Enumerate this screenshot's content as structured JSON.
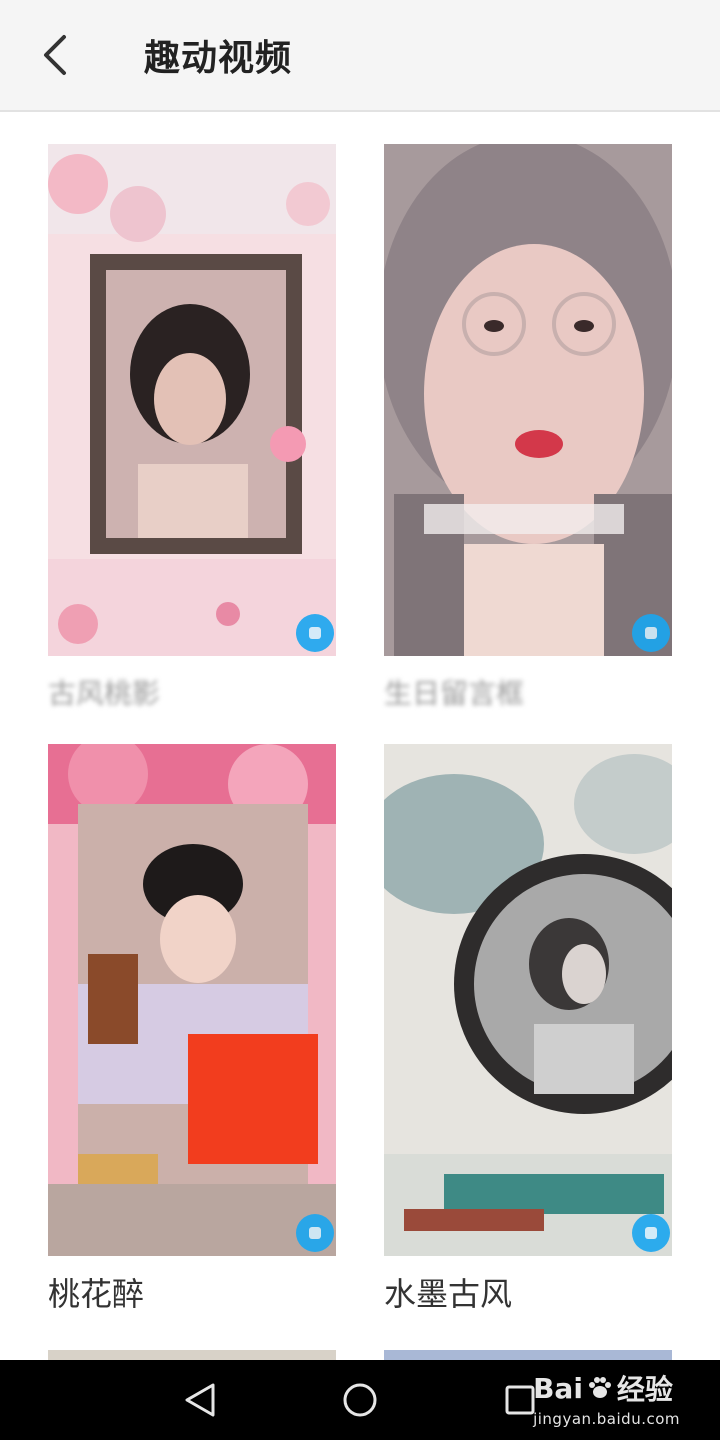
{
  "header": {
    "title": "趣动视频",
    "back_icon": "chevron-left-icon"
  },
  "cards": [
    {
      "title": "古风桃影"
    },
    {
      "title": "生日留言框"
    },
    {
      "title": "桃花醉"
    },
    {
      "title": "水墨古风"
    }
  ],
  "navbar": {
    "back_icon": "triangle-back-icon",
    "home_icon": "circle-home-icon",
    "recent_icon": "square-recent-icon"
  },
  "watermark": {
    "brand": "Bai",
    "brand_suffix": "经验",
    "url": "jingyan.baidu.com"
  },
  "colors": {
    "badge": "#1aa6f0",
    "topbar": "#f5f5f5",
    "navbar": "#000000"
  }
}
